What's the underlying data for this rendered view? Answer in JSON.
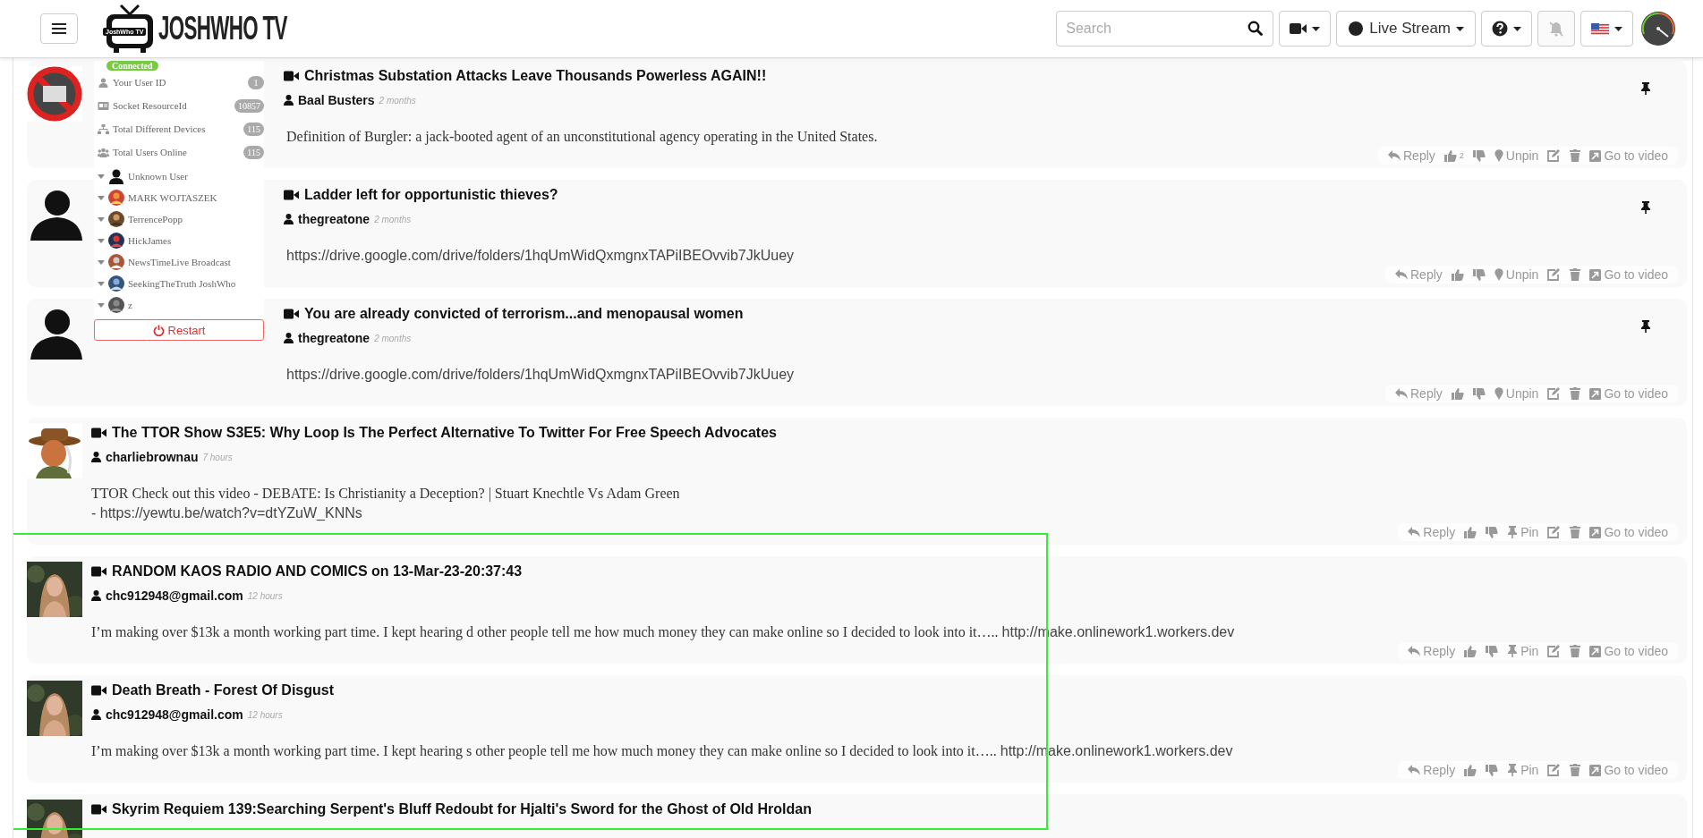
{
  "header": {
    "logo": {
      "badge": "JoshWho TV",
      "wordmark": "JOSHWHO TV"
    },
    "search": {
      "placeholder": "Search"
    },
    "live_stream": {
      "label": "Live Stream"
    },
    "notifications": {
      "disabled": true
    }
  },
  "connection_panel": {
    "status": "Connected",
    "stats": [
      {
        "kind": "user",
        "label": "Your User ID",
        "count": "1"
      },
      {
        "kind": "socket",
        "label": "Socket ResourceId",
        "count": "10857"
      },
      {
        "kind": "devices",
        "label": "Total Different Devices",
        "count": "115"
      },
      {
        "kind": "users",
        "label": "Total Users Online",
        "count": "115"
      }
    ],
    "users": [
      {
        "name": "Unknown User",
        "kind": "silhouette"
      },
      {
        "name": "MARK WOJTASZEK",
        "kind": "picture"
      },
      {
        "name": "TerrencePopp",
        "kind": "picture"
      },
      {
        "name": "HickJames",
        "kind": "picture"
      },
      {
        "name": "NewsTimeLive Broadcast",
        "kind": "picture"
      },
      {
        "name": "SeekingTheTruth JoshWho",
        "kind": "picture"
      },
      {
        "name": "z",
        "kind": "picture"
      }
    ],
    "restart": "Restart"
  },
  "posts": [
    {
      "avatar": {
        "kind": "picture"
      },
      "title": "Christmas Substation Attacks Leave Thousands Powerless AGAIN!!",
      "author": "Baal Busters",
      "time": "2 months",
      "pinned": true,
      "body": [
        [
          {
            "kind": "serif",
            "text": "Definition of Burgler: a jack-booted agent of an unconstitutional agency operating in the United States."
          }
        ]
      ],
      "actions": {
        "reply": "Reply",
        "likes": "2",
        "pin": "Unpin",
        "video": "Go to video"
      }
    },
    {
      "avatar": {
        "kind": "silhouette"
      },
      "title": "Ladder left for opportunistic thieves?",
      "author": "thegreatone",
      "time": "2 months",
      "pinned": true,
      "body": [
        [
          {
            "kind": "sans",
            "text": "https://drive.google.com/drive/folders/1hqUmWidQxmgnxTAPiIBEOvvib7JkUuey"
          }
        ]
      ],
      "actions": {
        "reply": "Reply",
        "pin": "Unpin",
        "video": "Go to video"
      }
    },
    {
      "avatar": {
        "kind": "silhouette"
      },
      "title": "You are already convicted of terrorism...and menopausal women",
      "author": "thegreatone",
      "time": "2 months",
      "pinned": true,
      "body": [
        [
          {
            "kind": "sans",
            "text": "https://drive.google.com/drive/folders/1hqUmWidQxmgnxTAPiIBEOvvib7JkUuey"
          }
        ]
      ],
      "actions": {
        "reply": "Reply",
        "pin": "Unpin",
        "video": "Go to video"
      }
    },
    {
      "avatar": {
        "kind": "picture"
      },
      "title": "The TTOR Show S3E5: Why Loop Is The Perfect Alternative To Twitter For Free Speech Advocates",
      "author": "charliebrownau",
      "time": "7 hours",
      "pinned": false,
      "body": [
        [
          {
            "kind": "serif",
            "text": "TTOR Check out this video - DEBATE: Is Christianity a Deception? | Stuart Knechtle Vs Adam Green"
          }
        ],
        [
          {
            "kind": "sans",
            "text": "- https://yewtu.be/watch?v=dtYZuW_KNNs"
          }
        ]
      ],
      "actions": {
        "reply": "Reply",
        "pin": "Pin",
        "video": "Go to video"
      }
    },
    {
      "avatar": {
        "kind": "picture"
      },
      "title": "RANDOM KAOS RADIO AND COMICS on 13-Mar-23-20:37:43",
      "author": "chc912948@gmail.com",
      "time": "12 hours",
      "pinned": false,
      "body": [
        [
          {
            "kind": "serif",
            "text": "I’m making over $13k a month working part time. I kept hearing d other people tell me how much money they can make online so I decided to look into it….. "
          },
          {
            "kind": "link",
            "text": "http://make.onlinework1.workers.dev"
          }
        ]
      ],
      "actions": {
        "reply": "Reply",
        "pin": "Pin",
        "video": "Go to video"
      }
    },
    {
      "avatar": {
        "kind": "picture"
      },
      "title": "Death Breath - Forest Of Disgust",
      "author": "chc912948@gmail.com",
      "time": "12 hours",
      "pinned": false,
      "body": [
        [
          {
            "kind": "serif",
            "text": "I’m making over $13k a month working part time. I kept hearing s other people tell me how much money they can make online so I decided to look into it….. "
          },
          {
            "kind": "link",
            "text": "http://make.onlinework1.workers.dev"
          }
        ]
      ],
      "actions": {
        "reply": "Reply",
        "pin": "Pin",
        "video": "Go to video"
      }
    },
    {
      "avatar": {
        "kind": "picture"
      },
      "title": "Skyrim Requiem 139:Searching Serpent's Bluff Redoubt for Hjalti's Sword for the Ghost of Old Hroldan",
      "pinned": false
    }
  ]
}
